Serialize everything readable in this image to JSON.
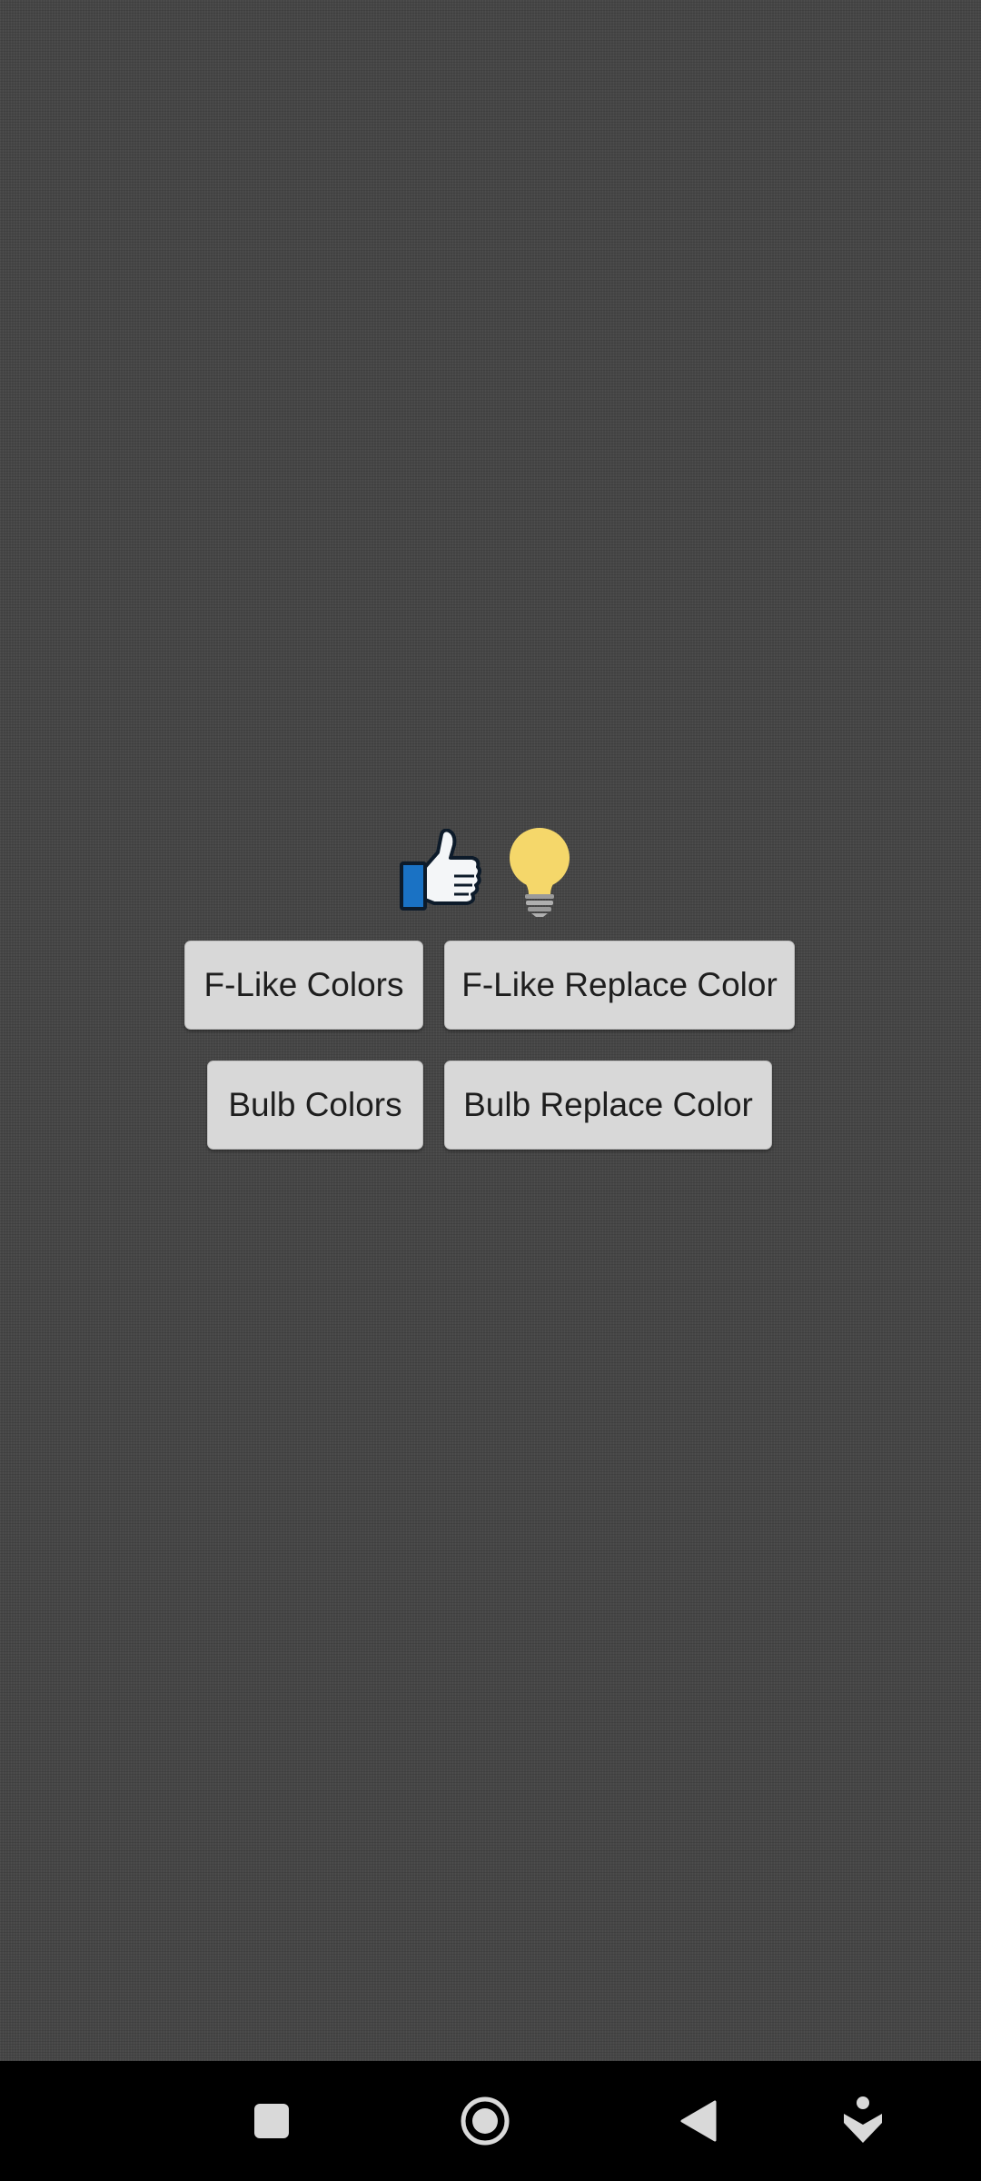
{
  "icons": {
    "like": "thumbs-up-icon",
    "bulb": "light-bulb-icon"
  },
  "buttons": {
    "flike_colors": "F-Like Colors",
    "flike_replace_color": "F-Like Replace Color",
    "bulb_colors": "Bulb Colors",
    "bulb_replace_color": "Bulb Replace Color"
  },
  "navigation": {
    "recents": "square-icon",
    "home": "circle-icon",
    "back": "triangle-back-icon",
    "extra": "accessibility-icon"
  },
  "colors": {
    "background": "#464646",
    "button": "#d8d8d8",
    "button_text": "#1e1e1e",
    "like_blue": "#1a72c4",
    "bulb_yellow": "#f5d76a",
    "nav_bar": "#000000"
  }
}
